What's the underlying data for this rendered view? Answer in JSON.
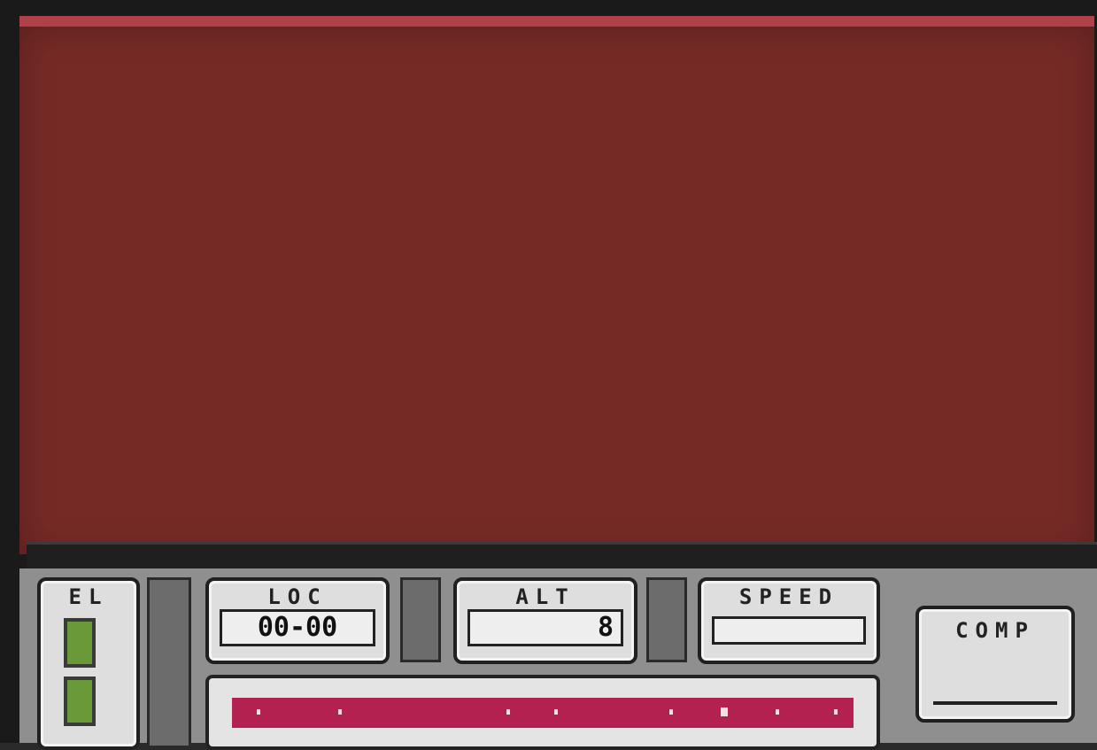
{
  "hud": {
    "fuel_label": "EL",
    "loc_label": "LOC",
    "loc_value": "00-00",
    "alt_label": "ALT",
    "alt_value": "8",
    "speed_label": "SPEED",
    "speed_value": "",
    "comp_label": "COMP",
    "comp_value": ""
  },
  "colors": {
    "sky": "#762a26",
    "radar_strip": "#b32150",
    "fuel_cell": "#6a9a38",
    "panel": "#dedede"
  }
}
